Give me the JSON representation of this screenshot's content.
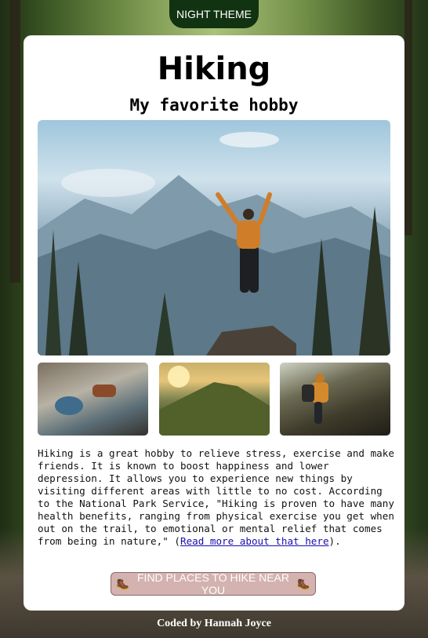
{
  "theme_button": {
    "label": "NIGHT THEME"
  },
  "card": {
    "title": "Hiking",
    "subtitle": "My favorite hobby",
    "paragraph_main": "Hiking is a great hobby to relieve stress, exercise and make friends. It is known to boost happiness and lower depression. It allows you to experience new things by visiting different areas with little to no cost. According to the National Park Service, \"Hiking is proven to have many health benefits, ranging from physical exercise you get when out on the trail, to emotional or mental relief that comes from being in nature,\" (",
    "link_text": "Read more about that here",
    "paragraph_end": ").",
    "find_button": {
      "icon_left": "🥾",
      "label": "FIND PLACES TO HIKE NEAR YOU",
      "icon_right": "🥾"
    }
  },
  "footer": {
    "text": "Coded by Hannah Joyce"
  },
  "colors": {
    "theme_button_bg": "#113311",
    "find_button_bg": "#d3b2b0",
    "card_bg": "#ffffff",
    "link": "#1a0dab"
  }
}
